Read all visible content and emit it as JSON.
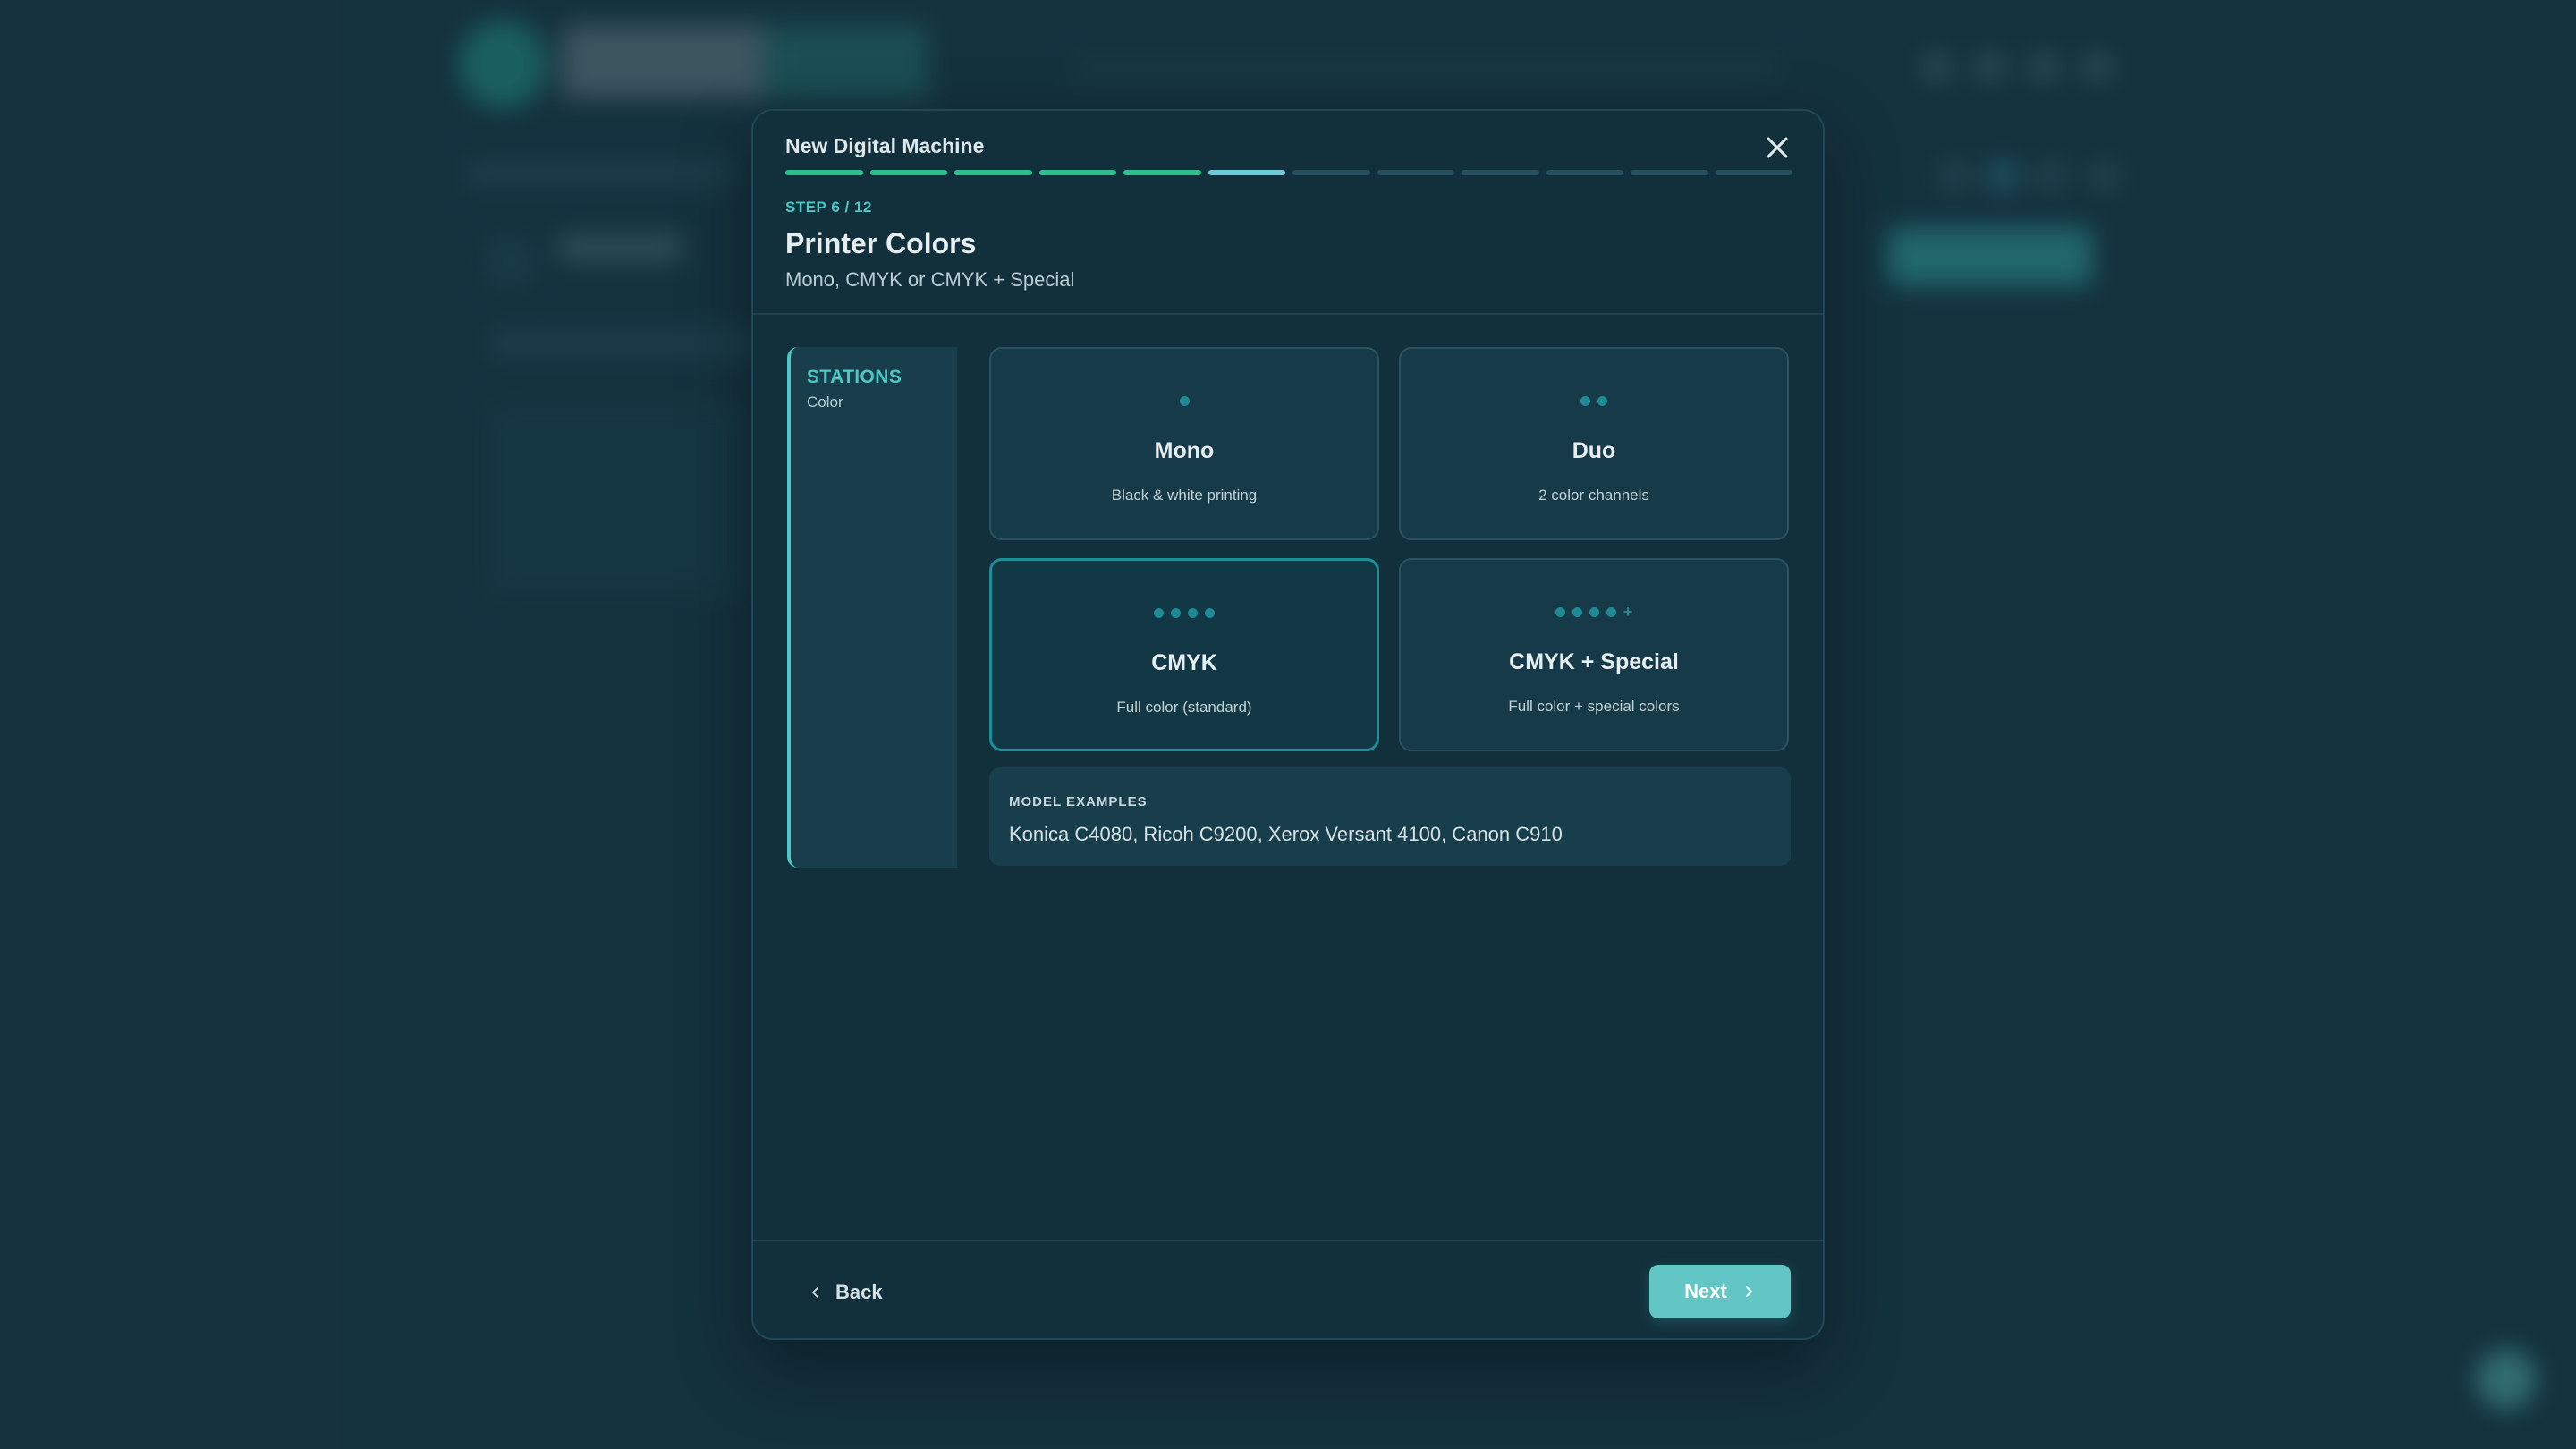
{
  "modal": {
    "title": "New Digital Machine",
    "progress": {
      "current_step": 6,
      "total_steps": 12
    },
    "step_label": "STEP 6 / 12",
    "step_title": "Printer Colors",
    "step_subtitle": "Mono, CMYK or CMYK + Special"
  },
  "side_panel": {
    "title": "STATIONS",
    "subtitle": "Color"
  },
  "options": [
    {
      "title": "Mono",
      "description": "Black & white printing",
      "dots": 1,
      "plus": false,
      "selected": false
    },
    {
      "title": "Duo",
      "description": "2 color channels",
      "dots": 2,
      "plus": false,
      "selected": false
    },
    {
      "title": "CMYK",
      "description": "Full color (standard)",
      "dots": 4,
      "plus": false,
      "selected": true
    },
    {
      "title": "CMYK + Special",
      "description": "Full color + special colors",
      "dots": 4,
      "plus": true,
      "selected": false
    }
  ],
  "examples": {
    "label": "MODEL EXAMPLES",
    "text": "Konica C4080, Ricoh C9200, Xerox Versant 4100, Canon C910"
  },
  "footer": {
    "back_label": "Back",
    "next_label": "Next"
  },
  "colors": {
    "accent": "#4cc8c4",
    "progress_done": "#2fbf8d",
    "progress_current": "#6ec9d6",
    "selected_border": "#1f8f97"
  }
}
